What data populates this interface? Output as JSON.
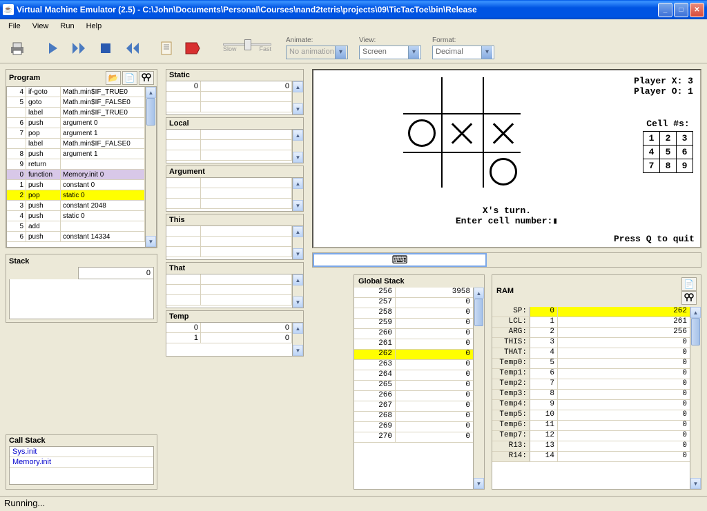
{
  "title": "Virtual Machine Emulator (2.5) - C:\\John\\Documents\\Personal\\Courses\\nand2tetris\\projects\\09\\TicTacToe\\bin\\Release",
  "menu": [
    "File",
    "View",
    "Run",
    "Help"
  ],
  "toolbar": {
    "animate_label": "Animate:",
    "animate_value": "No animation",
    "slow": "Slow",
    "fast": "Fast",
    "view_label": "View:",
    "view_value": "Screen",
    "format_label": "Format:",
    "format_value": "Decimal"
  },
  "program": {
    "label": "Program",
    "rows": [
      {
        "n": "4",
        "i": "if-goto",
        "a": "Math.min$IF_TRUE0"
      },
      {
        "n": "5",
        "i": "goto",
        "a": "Math.min$IF_FALSE0"
      },
      {
        "n": "",
        "i": "label",
        "a": "Math.min$IF_TRUE0"
      },
      {
        "n": "6",
        "i": "push",
        "a": "argument 0"
      },
      {
        "n": "7",
        "i": "pop",
        "a": "argument 1"
      },
      {
        "n": "",
        "i": "label",
        "a": "Math.min$IF_FALSE0"
      },
      {
        "n": "8",
        "i": "push",
        "a": "argument 1"
      },
      {
        "n": "9",
        "i": "return",
        "a": ""
      },
      {
        "n": "0",
        "i": "function",
        "a": "Memory.init 0",
        "cls": "hl-purple"
      },
      {
        "n": "1",
        "i": "push",
        "a": "constant 0"
      },
      {
        "n": "2",
        "i": "pop",
        "a": "static 0",
        "cls": "hl-yellow"
      },
      {
        "n": "3",
        "i": "push",
        "a": "constant 2048"
      },
      {
        "n": "4",
        "i": "push",
        "a": "static 0"
      },
      {
        "n": "5",
        "i": "add",
        "a": ""
      },
      {
        "n": "6",
        "i": "push",
        "a": "constant 14334"
      }
    ]
  },
  "segments": {
    "static": {
      "label": "Static",
      "rows": [
        {
          "a": "0",
          "v": "0"
        },
        {
          "a": "",
          "v": ""
        },
        {
          "a": "",
          "v": ""
        }
      ]
    },
    "local": {
      "label": "Local",
      "rows": [
        {
          "a": "",
          "v": ""
        },
        {
          "a": "",
          "v": ""
        },
        {
          "a": "",
          "v": ""
        }
      ]
    },
    "argument": {
      "label": "Argument",
      "rows": [
        {
          "a": "",
          "v": ""
        },
        {
          "a": "",
          "v": ""
        },
        {
          "a": "",
          "v": ""
        }
      ]
    },
    "this": {
      "label": "This",
      "rows": [
        {
          "a": "",
          "v": ""
        },
        {
          "a": "",
          "v": ""
        },
        {
          "a": "",
          "v": ""
        }
      ]
    },
    "that": {
      "label": "That",
      "rows": [
        {
          "a": "",
          "v": ""
        },
        {
          "a": "",
          "v": ""
        },
        {
          "a": "",
          "v": ""
        }
      ]
    },
    "temp": {
      "label": "Temp",
      "rows": [
        {
          "a": "0",
          "v": "0"
        },
        {
          "a": "1",
          "v": "0"
        }
      ]
    }
  },
  "stack": {
    "label": "Stack",
    "value": "0"
  },
  "callstack": {
    "label": "Call Stack",
    "items": [
      "Sys.init",
      "Memory.init"
    ]
  },
  "globalstack": {
    "label": "Global Stack",
    "rows": [
      {
        "a": "256",
        "v": "3958"
      },
      {
        "a": "257",
        "v": "0"
      },
      {
        "a": "258",
        "v": "0"
      },
      {
        "a": "259",
        "v": "0"
      },
      {
        "a": "260",
        "v": "0"
      },
      {
        "a": "261",
        "v": "0"
      },
      {
        "a": "262",
        "v": "0",
        "hl": true
      },
      {
        "a": "263",
        "v": "0"
      },
      {
        "a": "264",
        "v": "0"
      },
      {
        "a": "265",
        "v": "0"
      },
      {
        "a": "266",
        "v": "0"
      },
      {
        "a": "267",
        "v": "0"
      },
      {
        "a": "268",
        "v": "0"
      },
      {
        "a": "269",
        "v": "0"
      },
      {
        "a": "270",
        "v": "0"
      }
    ]
  },
  "ram": {
    "label": "RAM",
    "rows": [
      {
        "l": "SP:",
        "a": "0",
        "v": "262",
        "hl": true
      },
      {
        "l": "LCL:",
        "a": "1",
        "v": "261"
      },
      {
        "l": "ARG:",
        "a": "2",
        "v": "256"
      },
      {
        "l": "THIS:",
        "a": "3",
        "v": "0"
      },
      {
        "l": "THAT:",
        "a": "4",
        "v": "0"
      },
      {
        "l": "Temp0:",
        "a": "5",
        "v": "0"
      },
      {
        "l": "Temp1:",
        "a": "6",
        "v": "0"
      },
      {
        "l": "Temp2:",
        "a": "7",
        "v": "0"
      },
      {
        "l": "Temp3:",
        "a": "8",
        "v": "0"
      },
      {
        "l": "Temp4:",
        "a": "9",
        "v": "0"
      },
      {
        "l": "Temp5:",
        "a": "10",
        "v": "0"
      },
      {
        "l": "Temp6:",
        "a": "11",
        "v": "0"
      },
      {
        "l": "Temp7:",
        "a": "12",
        "v": "0"
      },
      {
        "l": "R13:",
        "a": "13",
        "v": "0"
      },
      {
        "l": "R14:",
        "a": "14",
        "v": "0"
      }
    ]
  },
  "screen": {
    "score": "Player X: 3\nPlayer O: 1",
    "cellnums_hdr": "Cell #s:",
    "turn": "X's turn.\nEnter cell number:▮",
    "quit": "Press Q to quit"
  },
  "status": "Running..."
}
